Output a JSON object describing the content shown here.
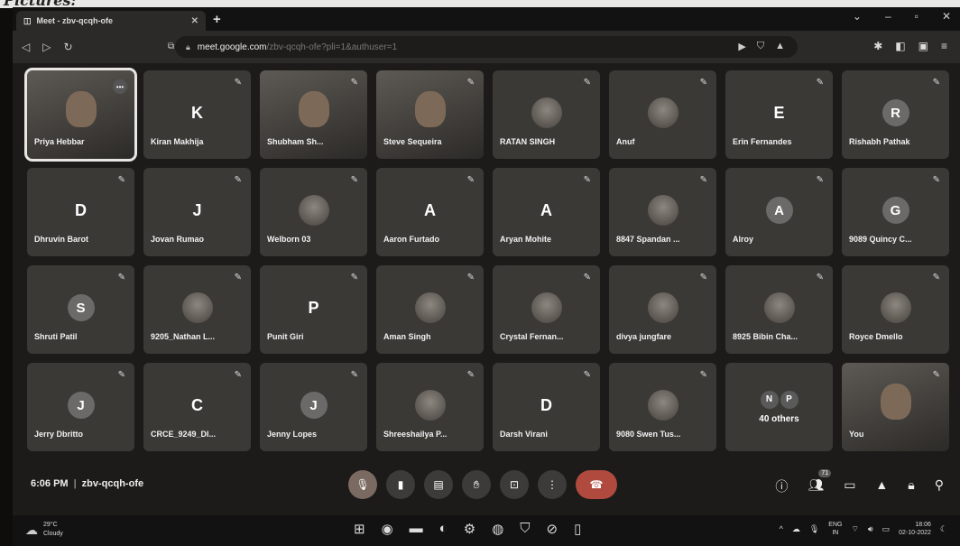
{
  "browser": {
    "tab_title": "Meet - zbv-qcqh-ofe",
    "url_host": "meet.google.com",
    "url_rest": "/zbv-qcqh-ofe?pli=1&authuser=1"
  },
  "participants": [
    {
      "name": "Priya Hebbar",
      "type": "video",
      "active": true
    },
    {
      "name": "Kiran Makhija",
      "type": "letter",
      "initial": "K"
    },
    {
      "name": "Shubham Sh...",
      "type": "video"
    },
    {
      "name": "Steve Sequeira",
      "type": "video"
    },
    {
      "name": "RATAN SINGH",
      "type": "photo"
    },
    {
      "name": "Anuf",
      "type": "photo"
    },
    {
      "name": "Erin Fernandes",
      "type": "letter",
      "initial": "E"
    },
    {
      "name": "Rishabh Pathak",
      "type": "avatar",
      "initial": "R"
    },
    {
      "name": "Dhruvin Barot",
      "type": "letter",
      "initial": "D"
    },
    {
      "name": "Jovan Rumao",
      "type": "letter",
      "initial": "J"
    },
    {
      "name": "Welborn 03",
      "type": "photo"
    },
    {
      "name": "Aaron Furtado",
      "type": "letter",
      "initial": "A"
    },
    {
      "name": "Aryan Mohite",
      "type": "letter",
      "initial": "A"
    },
    {
      "name": "8847 Spandan ...",
      "type": "photo"
    },
    {
      "name": "Alroy",
      "type": "avatar",
      "initial": "A"
    },
    {
      "name": "9089 Quincy C...",
      "type": "avatar",
      "initial": "G"
    },
    {
      "name": "Shruti Patil",
      "type": "avatar",
      "initial": "S"
    },
    {
      "name": "9205_Nathan L...",
      "type": "photo"
    },
    {
      "name": "Punit Giri",
      "type": "letter",
      "initial": "P"
    },
    {
      "name": "Aman Singh",
      "type": "photo"
    },
    {
      "name": "Crystal Fernan...",
      "type": "photo"
    },
    {
      "name": "divya jungfare",
      "type": "photo"
    },
    {
      "name": "8925 Bibin Cha...",
      "type": "photo"
    },
    {
      "name": "Royce Dmello",
      "type": "photo"
    },
    {
      "name": "Jerry Dbritto",
      "type": "avatar",
      "initial": "J"
    },
    {
      "name": "CRCE_9249_DI...",
      "type": "letter",
      "initial": "C"
    },
    {
      "name": "Jenny Lopes",
      "type": "avatar",
      "initial": "J"
    },
    {
      "name": "Shreeshailya P...",
      "type": "photo"
    },
    {
      "name": "Darsh Virani",
      "type": "letter",
      "initial": "D"
    },
    {
      "name": "9080 Swen Tus...",
      "type": "photo"
    },
    {
      "name": "others",
      "type": "others"
    },
    {
      "name": "You",
      "type": "self"
    }
  ],
  "others_tile": {
    "initials": [
      "N",
      "P"
    ],
    "label": "40 others"
  },
  "meeting": {
    "time": "6:06 PM",
    "code": "zbv-qcqh-ofe"
  },
  "people_count": "71",
  "taskbar": {
    "temp": "29°C",
    "condition": "Cloudy",
    "lang_top": "ENG",
    "lang_bottom": "IN",
    "time": "18:06",
    "date": "02-10-2022"
  },
  "colors": {
    "end_call": "#b04a3e",
    "tile": "#3a3936",
    "background": "#1c1b19"
  }
}
